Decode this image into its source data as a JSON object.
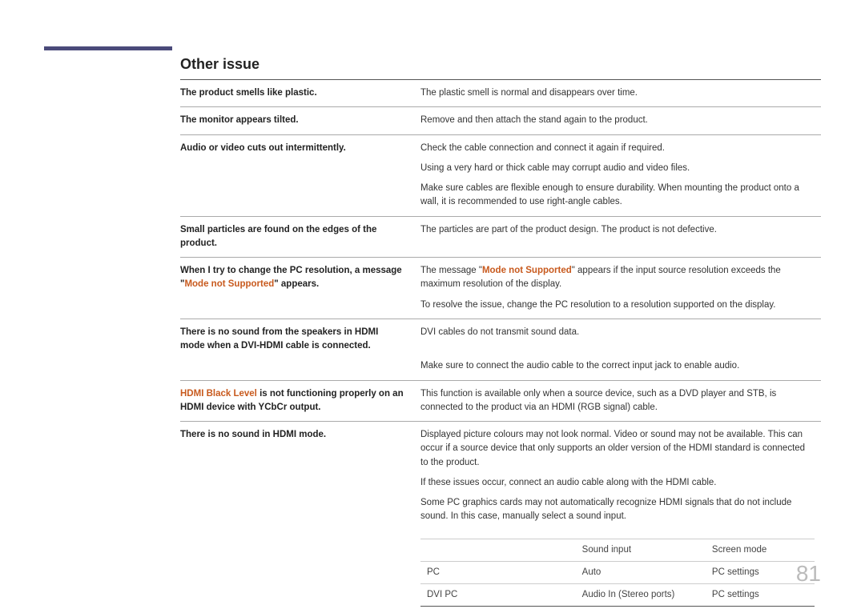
{
  "section_title": "Other issue",
  "rows": [
    {
      "left_plain": "The product smells like plastic.",
      "right": "The plastic smell is normal and disappears over time."
    },
    {
      "left_plain": "The monitor appears tilted.",
      "right": "Remove and then attach the stand again to the product."
    },
    {
      "left_plain": "Audio or video cuts out intermittently.",
      "right": "Check the cable connection and connect it again if required."
    },
    {
      "noborder": true,
      "left_plain": "",
      "right": "Using a very hard or thick cable may corrupt audio and video files."
    },
    {
      "noborder": true,
      "left_plain": "",
      "right": "Make sure cables are flexible enough to ensure durability. When mounting the product onto a wall, it is recommended to use right-angle cables."
    },
    {
      "left_plain": "Small particles are found on the edges of the product.",
      "right": "The particles are part of the product design. The product is not defective."
    },
    {
      "left_pre": "When I try to change the PC resolution, a message \"",
      "left_hl": "Mode not Supported",
      "left_post": "\" appears.",
      "right_pre": "The message \"",
      "right_hl": "Mode not Supported",
      "right_post": "\" appears if the input source resolution exceeds the maximum resolution of the display."
    },
    {
      "noborder": true,
      "left_plain": "",
      "right": "To resolve the issue, change the PC resolution to a resolution supported on the display."
    },
    {
      "left_plain": "There is no sound from the speakers in HDMI mode when a DVI-HDMI cable is connected.",
      "right": "DVI cables do not transmit sound data."
    },
    {
      "noborder": true,
      "left_plain": "",
      "right": "Make sure to connect the audio cable to the correct input jack to enable audio."
    },
    {
      "left_hl": "HDMI Black Level",
      "left_post": " is not functioning properly on an HDMI device with YCbCr output.",
      "right": "This function is available only when a source device, such as a DVD player and STB, is connected to the product via an HDMI (RGB signal) cable."
    },
    {
      "left_plain": "There is no sound in HDMI mode.",
      "right": "Displayed picture colours may not look normal. Video or sound may not be available. This can occur if a source device that only supports an older version of the HDMI standard is connected to the product."
    },
    {
      "noborder": true,
      "left_plain": "",
      "right": "If these issues occur, connect an audio cable along with the HDMI cable."
    },
    {
      "noborder": true,
      "left_plain": "",
      "right": "Some PC graphics cards may not automatically recognize HDMI signals that do not include sound. In this case, manually select a sound input."
    }
  ],
  "inner_table": {
    "header": [
      "",
      "Sound input",
      "Screen mode"
    ],
    "rows": [
      [
        "PC",
        "Auto",
        "PC settings"
      ],
      [
        "DVI PC",
        "Audio In (Stereo ports)",
        "PC settings"
      ]
    ]
  },
  "page_number": "81"
}
